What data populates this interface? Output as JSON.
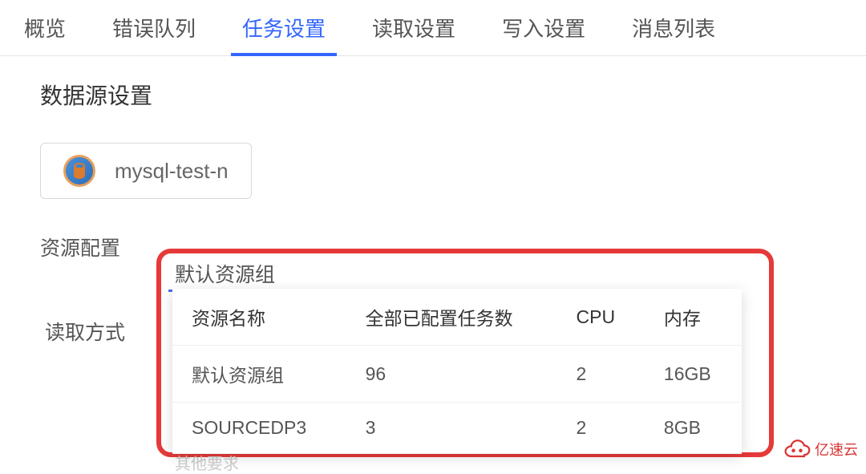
{
  "tabs": [
    {
      "label": "概览"
    },
    {
      "label": "错误队列"
    },
    {
      "label": "任务设置"
    },
    {
      "label": "读取设置"
    },
    {
      "label": "写入设置"
    },
    {
      "label": "消息列表"
    }
  ],
  "activeTabIndex": 2,
  "section": {
    "title": "数据源设置"
  },
  "datasource": {
    "name": "mysql-test-n",
    "icon": "mysql-icon"
  },
  "config": {
    "resource_label": "资源配置",
    "readmode_label": "读取方式",
    "dropdown_value": "默认资源组"
  },
  "resource_table": {
    "headers": [
      "资源名称",
      "全部已配置任务数",
      "CPU",
      "内存"
    ],
    "rows": [
      {
        "name": "默认资源组",
        "tasks": "96",
        "cpu": "2",
        "memory": "16GB"
      },
      {
        "name": "SOURCEDP3",
        "tasks": "3",
        "cpu": "2",
        "memory": "8GB"
      }
    ]
  },
  "faint_text": "其他要求",
  "watermark": "亿速云"
}
